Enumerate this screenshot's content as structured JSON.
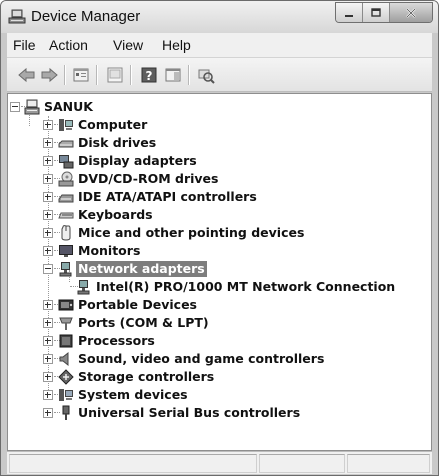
{
  "window": {
    "title": "Device Manager",
    "title_icon": "device-manager-icon"
  },
  "caption_buttons": [
    "minimize",
    "maximize",
    "close"
  ],
  "menu": [
    "File",
    "Action",
    "View",
    "Help"
  ],
  "toolbar": {
    "buttons": [
      "back-arrow-icon",
      "forward-arrow-icon",
      "properties-icon",
      "update-driver-icon",
      "help-icon",
      "action-pane-icon",
      "scan-hardware-icon"
    ]
  },
  "tree": {
    "root": "SANUK",
    "items": [
      {
        "label": "Computer",
        "icon": "computer-icon",
        "expanded": false
      },
      {
        "label": "Disk drives",
        "icon": "disk-drive-icon",
        "expanded": false
      },
      {
        "label": "Display adapters",
        "icon": "display-adapter-icon",
        "expanded": false
      },
      {
        "label": "DVD/CD-ROM drives",
        "icon": "dvd-drive-icon",
        "expanded": false
      },
      {
        "label": "IDE ATA/ATAPI controllers",
        "icon": "ide-controller-icon",
        "expanded": false
      },
      {
        "label": "Keyboards",
        "icon": "keyboard-icon",
        "expanded": false
      },
      {
        "label": "Mice and other pointing devices",
        "icon": "mouse-icon",
        "expanded": false
      },
      {
        "label": "Monitors",
        "icon": "monitor-icon",
        "expanded": false
      },
      {
        "label": "Network adapters",
        "icon": "network-adapter-icon",
        "expanded": true,
        "selected": true,
        "children": [
          {
            "label": "Intel(R) PRO/1000 MT Network Connection",
            "icon": "network-card-icon"
          }
        ]
      },
      {
        "label": "Portable Devices",
        "icon": "portable-device-icon",
        "expanded": false
      },
      {
        "label": "Ports (COM & LPT)",
        "icon": "port-icon",
        "expanded": false
      },
      {
        "label": "Processors",
        "icon": "processor-icon",
        "expanded": false
      },
      {
        "label": "Sound, video and game controllers",
        "icon": "sound-icon",
        "expanded": false
      },
      {
        "label": "Storage controllers",
        "icon": "storage-controller-icon",
        "expanded": false
      },
      {
        "label": "System devices",
        "icon": "system-device-icon",
        "expanded": false
      },
      {
        "label": "Universal Serial Bus controllers",
        "icon": "usb-icon",
        "expanded": false
      }
    ]
  },
  "colors": {
    "selection": "#7d7d7d",
    "window_frame": "#c9c9c9"
  }
}
